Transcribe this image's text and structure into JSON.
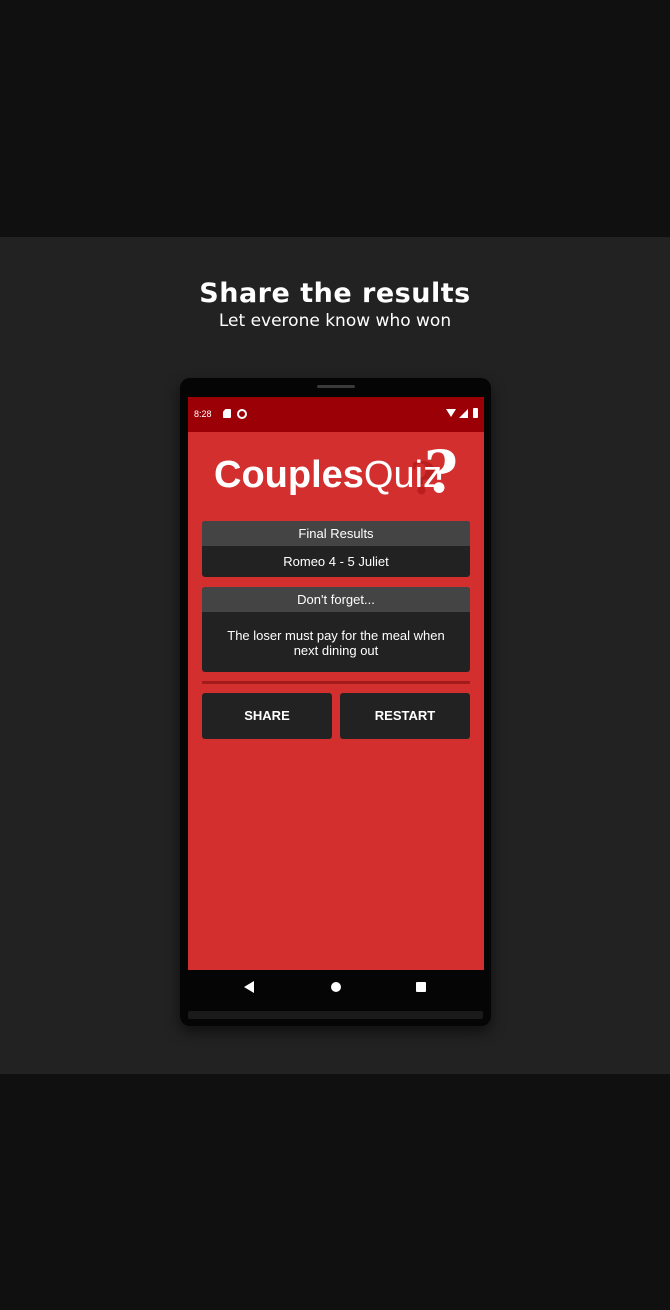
{
  "promo": {
    "title": "Share the results",
    "subtitle": "Let everone know who won"
  },
  "status_bar": {
    "time": "8:28",
    "icons": [
      "sd-card-icon",
      "sync-icon",
      "wifi-icon",
      "signal-icon",
      "battery-icon"
    ]
  },
  "app": {
    "logo_bold": "Couples",
    "logo_light": "Quiz",
    "logo_mark": "?"
  },
  "results_card": {
    "header": "Final Results",
    "score": "Romeo 4 - 5 Juliet"
  },
  "reminder_card": {
    "header": "Don't forget...",
    "message": "The loser must pay for the meal when next dining out"
  },
  "buttons": {
    "share": "SHARE",
    "restart": "RESTART"
  },
  "nav": {
    "icons": [
      "back-icon",
      "home-icon",
      "recents-icon"
    ]
  },
  "colors": {
    "background": "#101010",
    "band": "#222222",
    "app_red": "#d32f2f",
    "status_red": "#9b0007",
    "card": "#222222",
    "card_header": "#444444"
  }
}
